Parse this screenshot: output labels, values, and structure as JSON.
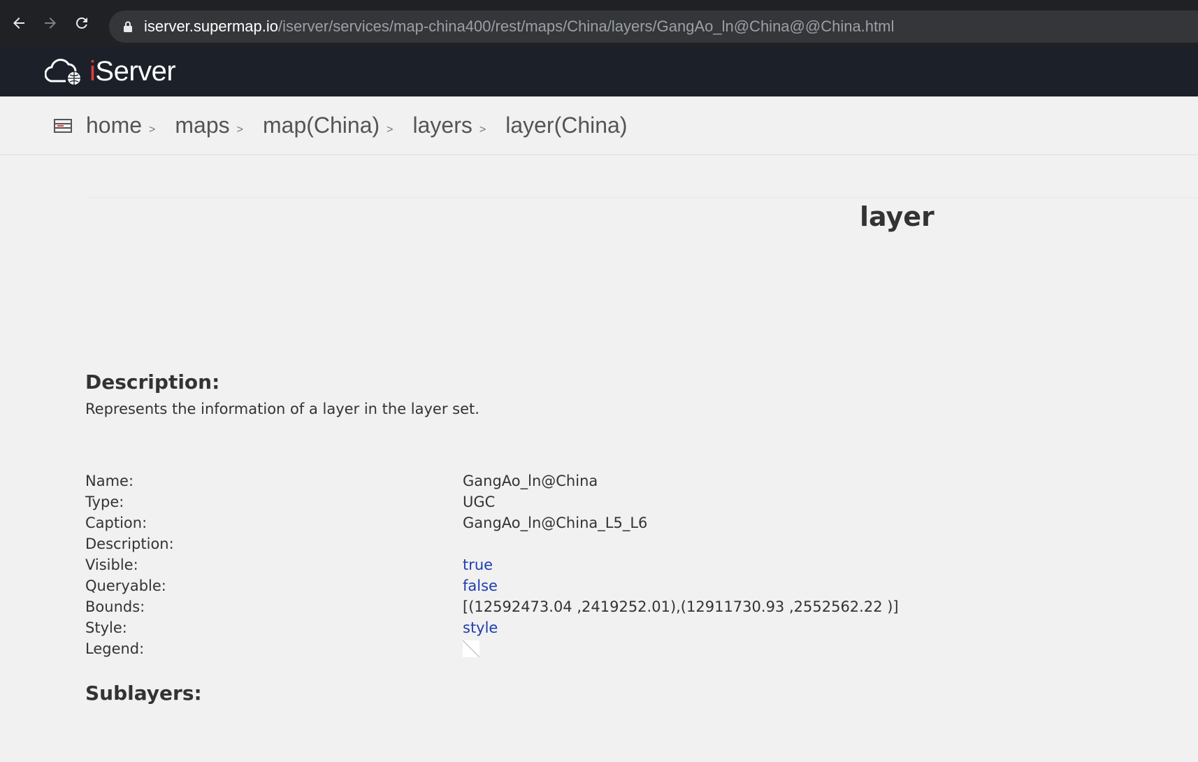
{
  "browser": {
    "url_host": "iserver.supermap.io",
    "url_path": "/iserver/services/map-china400/rest/maps/China/layers/GangAo_ln@China@@China.html"
  },
  "header": {
    "logo_text_i": "i",
    "logo_text_rest": "Server"
  },
  "breadcrumb": {
    "items": [
      {
        "label": "home",
        "sep": ">"
      },
      {
        "label": "maps",
        "sep": ">"
      },
      {
        "label": "map(China)",
        "sep": ">"
      },
      {
        "label": "layers",
        "sep": ">"
      },
      {
        "label": "layer(China)"
      }
    ]
  },
  "page": {
    "title": "layer",
    "description_heading": "Description:",
    "description_text": "Represents the information of a layer in the layer set.",
    "sublayers_heading": "Sublayers:"
  },
  "properties": [
    {
      "label": "Name:",
      "value": "GangAo_ln@China"
    },
    {
      "label": "Type:",
      "value": "UGC"
    },
    {
      "label": "Caption:",
      "value": "GangAo_ln@China_L5_L6"
    },
    {
      "label": "Description:",
      "value": ""
    },
    {
      "label": "Visible:",
      "value": "true"
    },
    {
      "label": "Queryable:",
      "value": "false"
    },
    {
      "label": "Bounds:",
      "value": "[(12592473.04 ,2419252.01),(12911730.93 ,2552562.22 )]"
    },
    {
      "label": "Style:",
      "value": "style"
    },
    {
      "label": "Legend:",
      "value": ""
    }
  ],
  "colors": {
    "link": "#1f3db0",
    "header_bg": "#1b2029",
    "logo_accent": "#e23c3c"
  }
}
